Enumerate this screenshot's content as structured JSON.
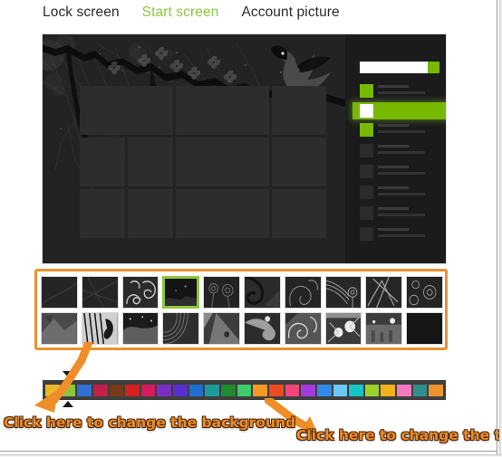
{
  "tabs": [
    {
      "label": "Lock screen",
      "active": false
    },
    {
      "label": "Start screen",
      "active": true
    },
    {
      "label": "Account picture",
      "active": false
    }
  ],
  "accent_color": "#76b900",
  "preview": {
    "name": "start-screen-preview",
    "background_theme": "dark cherry-blossom branch with hummingbird silhouette",
    "tile_grid": {
      "rows": 3,
      "columns": 4
    },
    "menu_panel": {
      "search_placeholder": "",
      "rows": 8,
      "selected_row_index": 2
    }
  },
  "background_picker": {
    "selected_index": 3,
    "thumbnails": [
      {
        "name": "background-1"
      },
      {
        "name": "background-2"
      },
      {
        "name": "background-3"
      },
      {
        "name": "background-4"
      },
      {
        "name": "background-5"
      },
      {
        "name": "background-6"
      },
      {
        "name": "background-7"
      },
      {
        "name": "background-8"
      },
      {
        "name": "background-9"
      },
      {
        "name": "background-10"
      },
      {
        "name": "background-11"
      },
      {
        "name": "background-12"
      },
      {
        "name": "background-13"
      },
      {
        "name": "background-14"
      },
      {
        "name": "background-15"
      },
      {
        "name": "background-16"
      },
      {
        "name": "background-17"
      },
      {
        "name": "background-18"
      },
      {
        "name": "background-19"
      },
      {
        "name": "background-20"
      }
    ]
  },
  "color_picker": {
    "selected_index": 1,
    "swatches": [
      "#e8b829",
      "#8cc63f",
      "#2f6fd6",
      "#c22048",
      "#7a3a16",
      "#d32020",
      "#d61a5e",
      "#7a2fc4",
      "#5a2fd0",
      "#1f6fd0",
      "#1f9a9a",
      "#1f8a2f",
      "#3ecb6a",
      "#f59a24",
      "#f04a24",
      "#f0487e",
      "#a33ae0",
      "#2f8ae8",
      "#6cc8f5",
      "#17c4c4",
      "#9ad12a",
      "#f0b11a",
      "#f27bc0",
      "#2f8f8f",
      "#f0922e"
    ]
  },
  "callouts": [
    {
      "name": "callout-background",
      "text": "Click here to change the background"
    },
    {
      "name": "callout-theme",
      "text": "Click here to change the theme"
    }
  ]
}
